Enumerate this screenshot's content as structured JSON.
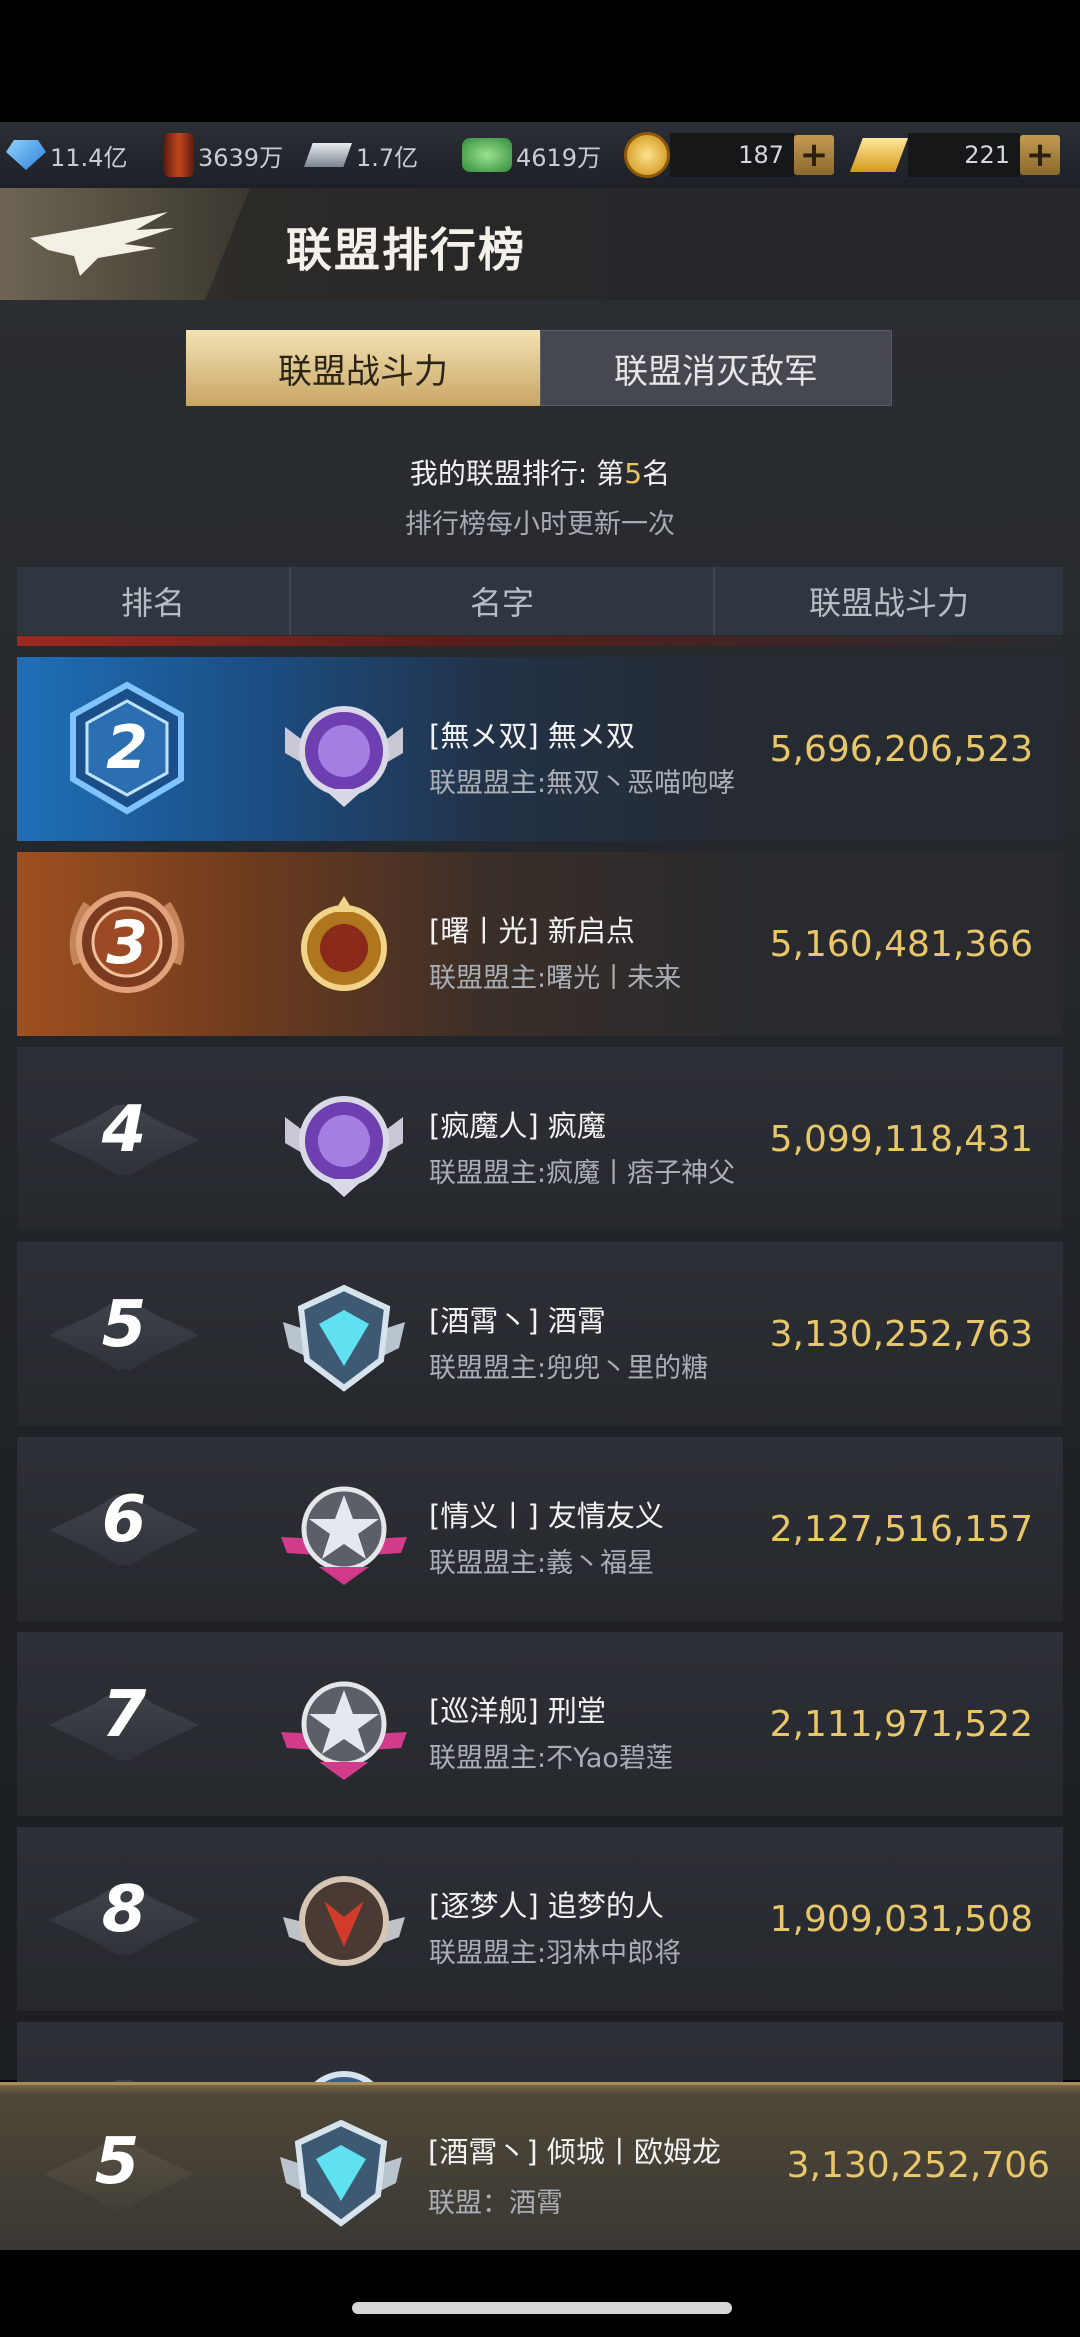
{
  "resources": {
    "crystal": "11.4亿",
    "oil": "3639万",
    "steel": "1.7亿",
    "cash": "4619万",
    "coins": "187",
    "gold": "221"
  },
  "header": {
    "title": "联盟排行榜"
  },
  "tabs": [
    {
      "label": "联盟战斗力",
      "active": true
    },
    {
      "label": "联盟消灭敌军",
      "active": false
    }
  ],
  "my_rank": {
    "prefix": "我的联盟排行: 第",
    "rank": "5",
    "suffix": "名",
    "note": "排行榜每小时更新一次"
  },
  "table": {
    "headers": {
      "rank": "排名",
      "name": "名字",
      "power": "联盟战斗力"
    },
    "rows": [
      {
        "rank": "2",
        "name": "[無メ双] 無メ双",
        "leader": "联盟盟主:無双丶恶喵咆哮",
        "power": "5,696,206,523",
        "emblem": "purple-lion-emblem"
      },
      {
        "rank": "3",
        "name": "[曙丨光] 新启点",
        "leader": "联盟盟主:曙光丨未来",
        "power": "5,160,481,366",
        "emblem": "gold-crest-emblem"
      },
      {
        "rank": "4",
        "name": "[疯魔人] 疯魔",
        "leader": "联盟盟主:疯魔丨痞子神父",
        "power": "5,099,118,431",
        "emblem": "purple-lion-emblem"
      },
      {
        "rank": "5",
        "name": "[酒霄丶] 酒霄",
        "leader": "联盟盟主:兜兜丶里的糖",
        "power": "3,130,252,763",
        "emblem": "cyan-shield-emblem"
      },
      {
        "rank": "6",
        "name": "[情义丨] 友情友义",
        "leader": "联盟盟主:義丶福星",
        "power": "2,127,516,157",
        "emblem": "pink-star-emblem"
      },
      {
        "rank": "7",
        "name": "[巡洋舰] 刑堂",
        "leader": "联盟盟主:不Yao碧莲",
        "power": "2,111,971,522",
        "emblem": "pink-star-emblem"
      },
      {
        "rank": "8",
        "name": "[逐梦人] 追梦的人",
        "leader": "联盟盟主:羽林中郎将",
        "power": "1,909,031,508",
        "emblem": "red-beast-emblem"
      }
    ]
  },
  "my_alliance": {
    "rank": "5",
    "name": "[酒霄丶] 倾城丨欧姆龙",
    "alliance": "联盟：酒霄",
    "power": "3,130,252,706",
    "emblem": "cyan-shield-emblem"
  },
  "colors": {
    "accent_gold": "#e8c66a",
    "tab_active": "#e6d09a",
    "header_bg": "#2e3640"
  }
}
